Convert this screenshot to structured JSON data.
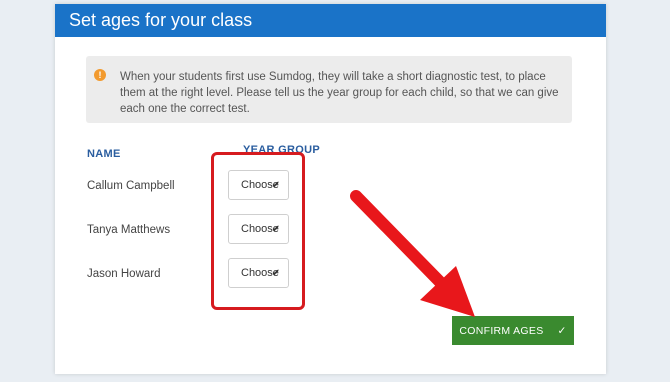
{
  "dialog": {
    "title": "Set ages for your class",
    "info": "When your students first use Sumdog, they will take a short diagnostic test, to place them at the right level. Please tell us the year group for each child, so that we can give each one the correct test.",
    "info_icon": "!"
  },
  "table": {
    "name_header": "NAME",
    "year_header": "YEAR GROUP",
    "rows": [
      {
        "name": "Callum Campbell",
        "select_value": "Choose"
      },
      {
        "name": "Tanya Matthews",
        "select_value": "Choose"
      },
      {
        "name": "Jason Howard",
        "select_value": "Choose"
      }
    ]
  },
  "confirm": {
    "label": "CONFIRM AGES",
    "icon": "check-icon"
  },
  "colors": {
    "header": "#1a73c8",
    "confirm": "#3a8a2f",
    "annotation": "#d61b1f"
  }
}
